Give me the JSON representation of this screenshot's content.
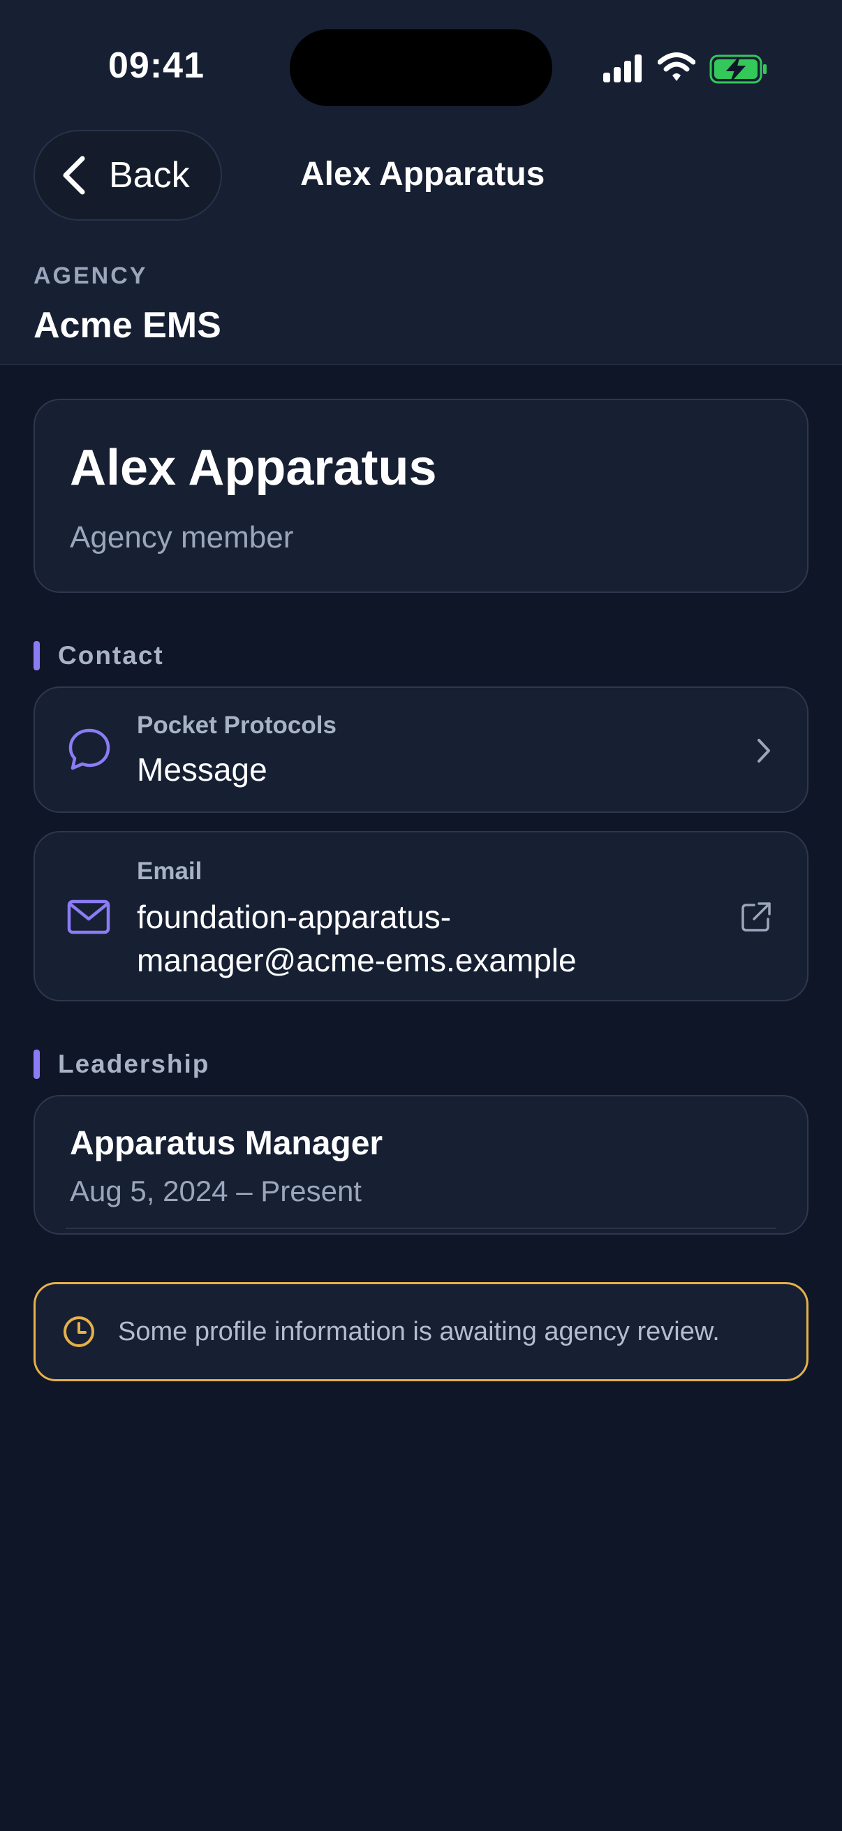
{
  "status_bar": {
    "time": "09:41"
  },
  "nav": {
    "back_label": "Back",
    "title": "Alex Apparatus"
  },
  "agency": {
    "label": "AGENCY",
    "name": "Acme EMS"
  },
  "profile": {
    "name": "Alex Apparatus",
    "role": "Agency member"
  },
  "contact": {
    "section_title": "Contact",
    "message": {
      "kicker": "Pocket Protocols",
      "value": "Message",
      "icon": "chat-bubble-icon",
      "trail_icon": "chevron-right-icon"
    },
    "email": {
      "kicker": "Email",
      "value_line1": "foundation-apparatus-",
      "value_line2": "manager@acme-ems.example",
      "icon": "mail-icon",
      "trail_icon": "external-link-icon"
    }
  },
  "leadership": {
    "section_title": "Leadership",
    "items": [
      {
        "title": "Apparatus Manager",
        "dates": "Aug 5, 2024 – Present"
      }
    ]
  },
  "notice": {
    "text": "Some profile information is awaiting agency review.",
    "icon": "clock-icon"
  },
  "colors": {
    "accent": "#8b7cf6",
    "warning": "#e6b04a",
    "battery": "#34c759",
    "background": "#0f1628",
    "card": "#172033"
  }
}
